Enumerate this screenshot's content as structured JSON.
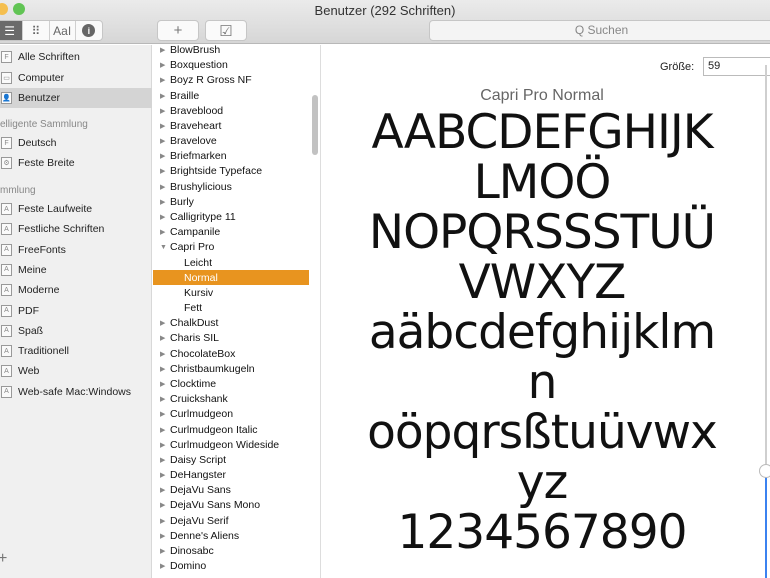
{
  "window": {
    "title": "Benutzer (292 Schriften)"
  },
  "toolbar": {
    "view_list": "☰",
    "view_grid": "⠿",
    "view_sample": "AaI",
    "view_info": "i",
    "add": "+",
    "validate": "☑",
    "search_placeholder": "Q Suchen"
  },
  "sidebar": {
    "top": [
      {
        "label": "Alle Schriften",
        "icon": "F"
      },
      {
        "label": "Computer",
        "icon": "▭"
      },
      {
        "label": "Benutzer",
        "icon": "👤"
      }
    ],
    "smart_header": "elligente Sammlung",
    "smart": [
      {
        "label": "Deutsch",
        "icon": "F"
      },
      {
        "label": "Feste Breite",
        "icon": "⚙"
      }
    ],
    "coll_header": "mmlung",
    "collections": [
      {
        "label": "Feste Laufweite"
      },
      {
        "label": "Festliche Schriften"
      },
      {
        "label": "FreeFonts"
      },
      {
        "label": "Meine"
      },
      {
        "label": "Moderne"
      },
      {
        "label": "PDF"
      },
      {
        "label": "Spaß"
      },
      {
        "label": "Traditionell"
      },
      {
        "label": "Web"
      },
      {
        "label": "Web-safe Mac:Windows"
      }
    ],
    "coll_icon": "A",
    "add": "+"
  },
  "fonts": [
    "BlowBrush",
    "Boxquestion",
    "Boyz R Gross NF",
    "Braille",
    "Braveblood",
    "Braveheart",
    "Bravelove",
    "Briefmarken",
    "Brightside Typeface",
    "Brushylicious",
    "Burly",
    "Calligritype 11",
    "Campanile",
    "Capri Pro",
    "Leicht",
    "Normal",
    "Kursiv",
    "Fett",
    "ChalkDust",
    "Charis SIL",
    "ChocolateBox",
    "Christbaumkugeln",
    "Clocktime",
    "Cruickshank",
    "Curlmudgeon",
    "Curlmudgeon Italic",
    "Curlmudgeon Wideside",
    "Daisy Script",
    "DeHangster",
    "DejaVu Sans",
    "DejaVu Sans Mono",
    "DejaVu Serif",
    "Denne's Aliens",
    "Dinosabc",
    "Domino"
  ],
  "selected_font": "Normal",
  "preview": {
    "size_label": "Größe:",
    "size": "59",
    "size_slider": 0.2,
    "font_name": "Capri Pro Normal",
    "lines": [
      "AABCDEFGHIJK",
      "LMOÖ",
      "NOPQRSSSTUÜ",
      "VWXYZ",
      "aäbcdefghijklm",
      "n",
      "oöpqrsßtuüvwx",
      "yz",
      "1234567890"
    ]
  },
  "colors": {
    "selection": "#e8941f",
    "accent": "#3b82f0"
  }
}
